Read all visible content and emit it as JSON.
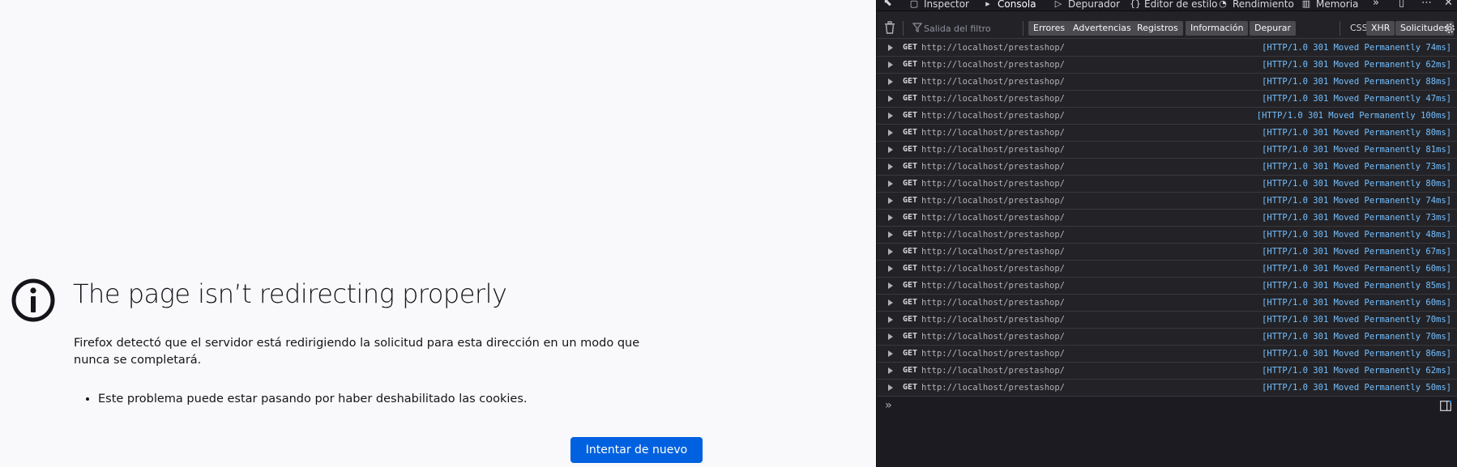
{
  "error_page": {
    "title": "The page isn’t redirecting properly",
    "description": "Firefox detectó que el servidor está redirigiendo la solicitud para esta dirección en un modo que nunca se completará.",
    "bullets": [
      "Este problema puede estar pasando por haber deshabilitado las cookies."
    ],
    "retry_button": "Intentar de nuevo",
    "icon": "info-icon"
  },
  "devtools": {
    "tabs": [
      {
        "label": "Inspector",
        "icon": "inspector-icon"
      },
      {
        "label": "Consola",
        "icon": "console-icon",
        "active": true
      },
      {
        "label": "Depurador",
        "icon": "debugger-icon"
      },
      {
        "label": "Editor de estilo",
        "icon": "style-editor-icon"
      },
      {
        "label": "Rendimiento",
        "icon": "performance-icon"
      },
      {
        "label": "Memoria",
        "icon": "memory-icon"
      }
    ],
    "filter_placeholder": "Salida del filtro",
    "filter_buttons": [
      "Errores",
      "Advertencias",
      "Registros",
      "Información",
      "Depurar"
    ],
    "extra_filters": [
      "CSS",
      "XHR",
      "Solicitudes"
    ],
    "log_entries": [
      {
        "method": "GET",
        "url": "http://localhost/prestashop/",
        "status": "[HTTP/1.0 301 Moved Permanently 74ms]"
      },
      {
        "method": "GET",
        "url": "http://localhost/prestashop/",
        "status": "[HTTP/1.0 301 Moved Permanently 62ms]"
      },
      {
        "method": "GET",
        "url": "http://localhost/prestashop/",
        "status": "[HTTP/1.0 301 Moved Permanently 88ms]"
      },
      {
        "method": "GET",
        "url": "http://localhost/prestashop/",
        "status": "[HTTP/1.0 301 Moved Permanently 47ms]"
      },
      {
        "method": "GET",
        "url": "http://localhost/prestashop/",
        "status": "[HTTP/1.0 301 Moved Permanently 100ms]"
      },
      {
        "method": "GET",
        "url": "http://localhost/prestashop/",
        "status": "[HTTP/1.0 301 Moved Permanently 80ms]"
      },
      {
        "method": "GET",
        "url": "http://localhost/prestashop/",
        "status": "[HTTP/1.0 301 Moved Permanently 81ms]"
      },
      {
        "method": "GET",
        "url": "http://localhost/prestashop/",
        "status": "[HTTP/1.0 301 Moved Permanently 73ms]"
      },
      {
        "method": "GET",
        "url": "http://localhost/prestashop/",
        "status": "[HTTP/1.0 301 Moved Permanently 80ms]"
      },
      {
        "method": "GET",
        "url": "http://localhost/prestashop/",
        "status": "[HTTP/1.0 301 Moved Permanently 74ms]"
      },
      {
        "method": "GET",
        "url": "http://localhost/prestashop/",
        "status": "[HTTP/1.0 301 Moved Permanently 73ms]"
      },
      {
        "method": "GET",
        "url": "http://localhost/prestashop/",
        "status": "[HTTP/1.0 301 Moved Permanently 48ms]"
      },
      {
        "method": "GET",
        "url": "http://localhost/prestashop/",
        "status": "[HTTP/1.0 301 Moved Permanently 67ms]"
      },
      {
        "method": "GET",
        "url": "http://localhost/prestashop/",
        "status": "[HTTP/1.0 301 Moved Permanently 60ms]"
      },
      {
        "method": "GET",
        "url": "http://localhost/prestashop/",
        "status": "[HTTP/1.0 301 Moved Permanently 85ms]"
      },
      {
        "method": "GET",
        "url": "http://localhost/prestashop/",
        "status": "[HTTP/1.0 301 Moved Permanently 60ms]"
      },
      {
        "method": "GET",
        "url": "http://localhost/prestashop/",
        "status": "[HTTP/1.0 301 Moved Permanently 70ms]"
      },
      {
        "method": "GET",
        "url": "http://localhost/prestashop/",
        "status": "[HTTP/1.0 301 Moved Permanently 70ms]"
      },
      {
        "method": "GET",
        "url": "http://localhost/prestashop/",
        "status": "[HTTP/1.0 301 Moved Permanently 86ms]"
      },
      {
        "method": "GET",
        "url": "http://localhost/prestashop/",
        "status": "[HTTP/1.0 301 Moved Permanently 62ms]"
      },
      {
        "method": "GET",
        "url": "http://localhost/prestashop/",
        "status": "[HTTP/1.0 301 Moved Permanently 50ms]"
      }
    ],
    "prompt_symbol": "»",
    "colors": {
      "background": "#232327",
      "status_link": "#75bfff",
      "button_blue": "#0061e0"
    }
  }
}
